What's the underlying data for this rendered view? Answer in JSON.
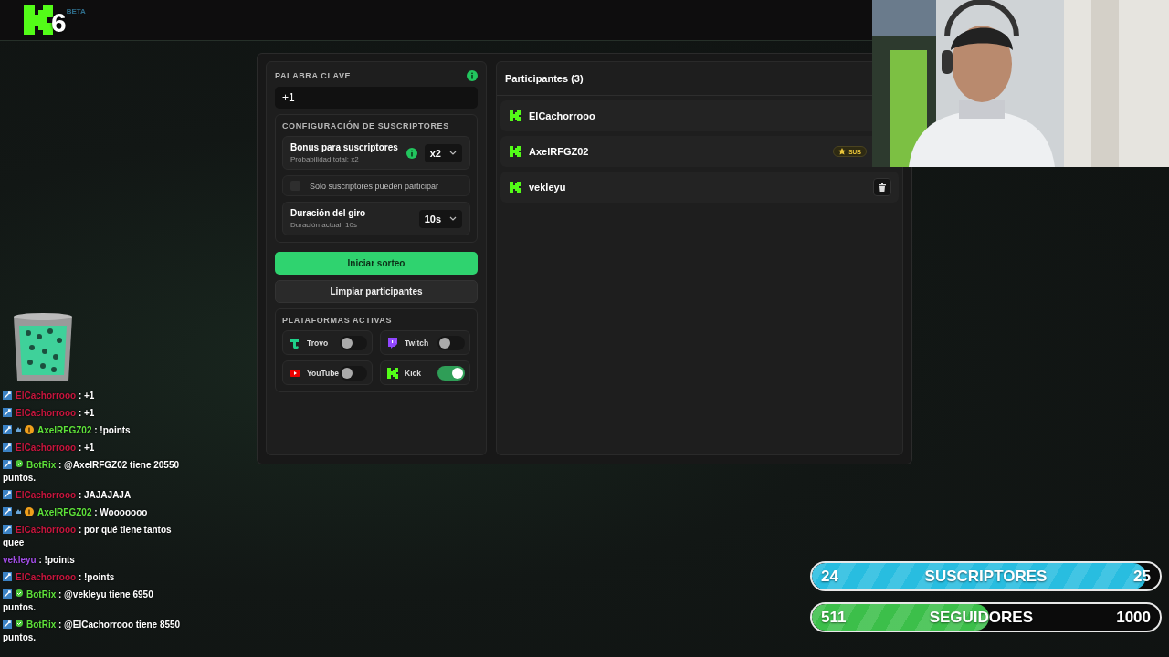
{
  "logo": {
    "digit": "6",
    "tag": "BETA"
  },
  "keyword": {
    "label": "PALABRA CLAVE",
    "value": "+1"
  },
  "subscriber_config": {
    "title": "CONFIGURACIÓN DE SUSCRIPTORES",
    "bonus": {
      "label": "Bonus para suscriptores",
      "hint": "Probabilidad total: x2",
      "value": "x2"
    },
    "only_subs": {
      "label": "Solo suscriptores pueden participar",
      "checked": false
    },
    "duration": {
      "label": "Duración del giro",
      "hint": "Duración actual: 10s",
      "value": "10s"
    }
  },
  "buttons": [
    {
      "label": "Iniciar sorteo",
      "kind": "primary"
    },
    {
      "label": "Limpiar participantes",
      "kind": "secondary"
    }
  ],
  "platforms": {
    "title": "PLATAFORMAS ACTIVAS",
    "items": [
      {
        "name": "Trovo",
        "kind": "trovo",
        "on": false
      },
      {
        "name": "Twitch",
        "kind": "twitch",
        "on": false
      },
      {
        "name": "YouTube",
        "kind": "youtube",
        "on": false
      },
      {
        "name": "Kick",
        "kind": "kick",
        "on": true
      }
    ]
  },
  "participants": {
    "title": "Participantes (3)",
    "items": [
      {
        "name": "ElCachorrooo",
        "sub": false,
        "delete_shown": false
      },
      {
        "name": "AxelRFGZ02",
        "sub": true,
        "sub_label": "SUB",
        "delete_shown": false
      },
      {
        "name": "vekleyu",
        "sub": false,
        "delete_shown": true
      }
    ]
  },
  "chat": [
    {
      "platform_badge": true,
      "crown_badge": false,
      "coin_badge": false,
      "bot_badge": false,
      "user": "ElCachorrooo",
      "color": "#c8163e",
      "text": ": +1"
    },
    {
      "platform_badge": true,
      "crown_badge": false,
      "coin_badge": false,
      "bot_badge": false,
      "user": "ElCachorrooo",
      "color": "#c8163e",
      "text": ": +1"
    },
    {
      "platform_badge": true,
      "crown_badge": true,
      "coin_badge": true,
      "bot_badge": false,
      "user": "AxelRFGZ02",
      "color": "#5ee23a",
      "text": ": !points"
    },
    {
      "platform_badge": true,
      "crown_badge": false,
      "coin_badge": false,
      "bot_badge": false,
      "user": "ElCachorrooo",
      "color": "#c8163e",
      "text": ": +1"
    },
    {
      "platform_badge": true,
      "crown_badge": false,
      "coin_badge": false,
      "bot_badge": true,
      "user": "BotRix",
      "color": "#5ee23a",
      "text": ": @AxelRFGZ02 tiene 20550 puntos."
    },
    {
      "platform_badge": true,
      "crown_badge": false,
      "coin_badge": false,
      "bot_badge": false,
      "user": "ElCachorrooo",
      "color": "#c8163e",
      "text": ": JAJAJAJA"
    },
    {
      "platform_badge": true,
      "crown_badge": true,
      "coin_badge": true,
      "bot_badge": false,
      "user": "AxelRFGZ02",
      "color": "#5ee23a",
      "text": ": Wooooooo"
    },
    {
      "platform_badge": true,
      "crown_badge": false,
      "coin_badge": false,
      "bot_badge": false,
      "user": "ElCachorrooo",
      "color": "#c8163e",
      "text": ": por qué tiene tantos quee"
    },
    {
      "platform_badge": false,
      "crown_badge": false,
      "coin_badge": false,
      "bot_badge": false,
      "user": "vekleyu",
      "color": "#a24ee6",
      "text": ": !points"
    },
    {
      "platform_badge": true,
      "crown_badge": false,
      "coin_badge": false,
      "bot_badge": false,
      "user": "ElCachorrooo",
      "color": "#c8163e",
      "text": ": !points"
    },
    {
      "platform_badge": true,
      "crown_badge": false,
      "coin_badge": false,
      "bot_badge": true,
      "user": "BotRix",
      "color": "#5ee23a",
      "text": ": @vekleyu tiene 6950 puntos."
    },
    {
      "platform_badge": true,
      "crown_badge": false,
      "coin_badge": false,
      "bot_badge": true,
      "user": "BotRix",
      "color": "#5ee23a",
      "text": ": @ElCachorrooo tiene 8550 puntos."
    }
  ],
  "goals": [
    {
      "kind": "subs",
      "current": "24",
      "label": "SUSCRIPTORES",
      "target": "25",
      "level": 0.96
    },
    {
      "kind": "followers",
      "current": "511",
      "label": "SEGUIDORES",
      "target": "1000",
      "level": 0.51
    }
  ]
}
